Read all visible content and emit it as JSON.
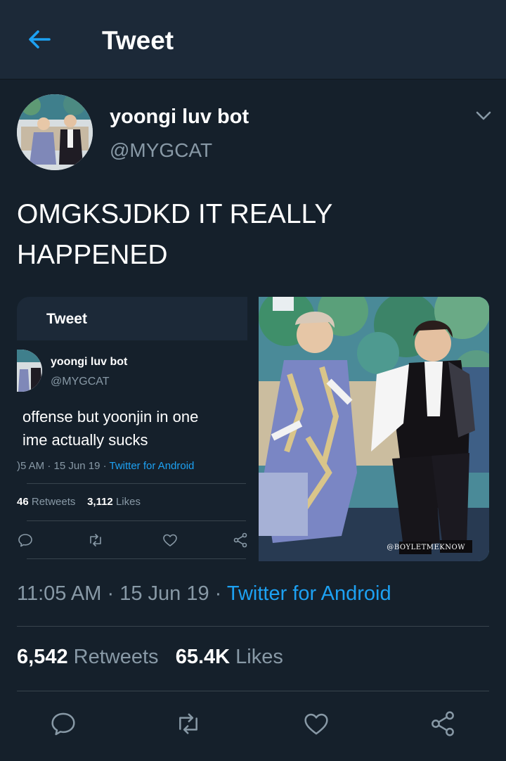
{
  "header": {
    "title": "Tweet"
  },
  "tweet": {
    "display_name": "yoongi luv bot",
    "handle": "@MYGCAT",
    "text_line1": "OMGKSJDKD IT REALLY",
    "text_line2": "HAPPENED",
    "time": "11:05 AM",
    "date": "15 Jun 19",
    "separator": "·",
    "source": "Twitter for Android",
    "retweets": "6,542",
    "retweets_label": "Retweets",
    "likes": "65.4K",
    "likes_label": "Likes"
  },
  "quoted_screenshot": {
    "header_title": "Tweet",
    "display_name": "yoongi luv bot",
    "handle": "@MYGCAT",
    "text_line1": "offense but yoonjin in one",
    "text_line2": "ime actually sucks",
    "time": ")5 AM",
    "date": "15 Jun 19",
    "separator": "·",
    "source": "Twitter for Android",
    "retweets": "46",
    "retweets_label": "Retweets",
    "likes": "3,112",
    "likes_label": "Likes"
  },
  "photo": {
    "watermark": "@BOYLETMEKNOW"
  },
  "colors": {
    "background": "#15202b",
    "header": "#1c2938",
    "accent": "#1da1f2",
    "secondary_text": "#8899a6",
    "divider": "#38444d"
  },
  "icons": {
    "back": "arrow-left-icon",
    "caret": "chevron-down-icon",
    "reply": "reply-icon",
    "retweet": "retweet-icon",
    "like": "heart-icon",
    "share": "share-icon"
  }
}
